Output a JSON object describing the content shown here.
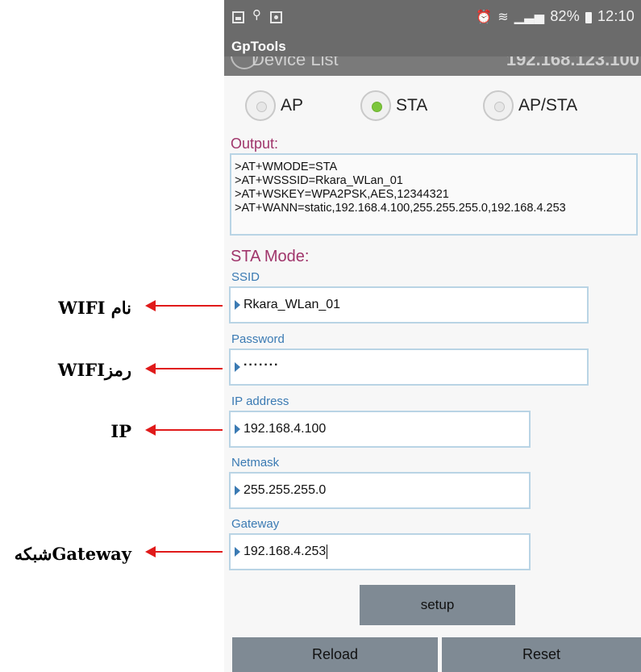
{
  "status_bar": {
    "battery": "82%",
    "time": "12:10"
  },
  "app": {
    "title": "GpTools",
    "device_list_label": "Device List",
    "device_ip": "192.168.123.100"
  },
  "mode": {
    "options": [
      "AP",
      "STA",
      "AP/STA"
    ],
    "selected": "STA"
  },
  "output": {
    "label": "Output:",
    "lines": [
      ">AT+WMODE=STA",
      ">AT+WSSSID=Rkara_WLan_01",
      ">AT+WSKEY=WPA2PSK,AES,12344321",
      ">AT+WANN=static,192.168.4.100,255.255.255.0,192.168.4.253"
    ]
  },
  "sta": {
    "title": "STA Mode:",
    "ssid_label": "SSID",
    "ssid_value": "Rkara_WLan_01",
    "password_label": "Password",
    "password_value": "·······",
    "ip_label": "IP address",
    "ip_value": "192.168.4.100",
    "netmask_label": "Netmask",
    "netmask_value": "255.255.255.0",
    "gateway_label": "Gateway",
    "gateway_value": "192.168.4.253"
  },
  "buttons": {
    "setup": "setup",
    "reload": "Reload",
    "reset": "Reset"
  },
  "annotations": {
    "ssid": "نام WIFI",
    "password": "رمزWIFI",
    "ip": "IP",
    "gateway": "Gatewayشبکه",
    "arrow_color": "#e01a1a"
  }
}
